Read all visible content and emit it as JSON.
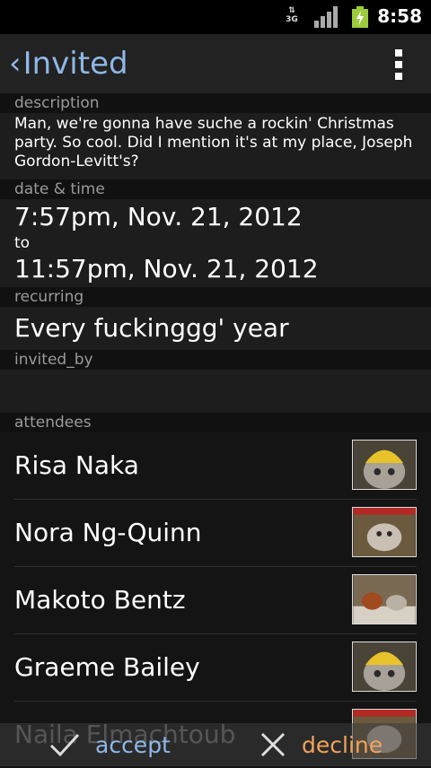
{
  "status_bar": {
    "network": "3G",
    "time": "8:58"
  },
  "action_bar": {
    "title": "Invited"
  },
  "sections": {
    "description_label": "description",
    "description_text": "Man, we're gonna have suche a rockin' Christmas party. So cool. Did I mention it's at my place, Joseph Gordon-Levitt's?",
    "datetime_label": "date & time",
    "start": "7:57pm, Nov. 21, 2012",
    "to_label": "to",
    "end": "11:57pm, Nov. 21, 2012",
    "recurring_label": "recurring",
    "recurring_value": "Every fuckinggg' year",
    "invited_by_label": "invited_by",
    "invited_by_value": "",
    "attendees_label": "attendees"
  },
  "attendees": [
    {
      "name": "Risa Naka"
    },
    {
      "name": "Nora Ng-Quinn"
    },
    {
      "name": "Makoto Bentz"
    },
    {
      "name": "Graeme Bailey"
    },
    {
      "name": "Naila Elmachtoub"
    }
  ],
  "bottom_bar": {
    "accept_label": "accept",
    "decline_label": "decline"
  }
}
